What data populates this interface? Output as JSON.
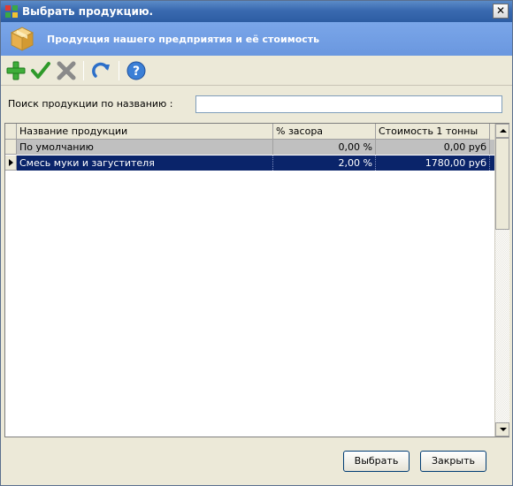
{
  "window": {
    "title": "Выбрать продукцию."
  },
  "banner": {
    "title": "Продукция нашего предприятия и её стоимость"
  },
  "toolbar": {
    "icons": [
      "add-icon",
      "accept-icon",
      "delete-icon",
      "refresh-icon",
      "help-icon"
    ]
  },
  "search": {
    "label": "Поиск продукции по названию :",
    "value": ""
  },
  "grid": {
    "columns": [
      "Название продукции",
      "% засора",
      "Стоимость 1 тонны"
    ],
    "rows": [
      {
        "name": "По умолчанию",
        "percent": "0,00 %",
        "price": "0,00 руб"
      },
      {
        "name": "Смесь муки и загустителя",
        "percent": "2,00 %",
        "price": "1780,00 руб"
      }
    ]
  },
  "buttons": {
    "select": "Выбрать",
    "close": "Закрыть"
  },
  "colors": {
    "selection": "#0a246a",
    "banner": "#6a97df",
    "titlebar": "#3a6ab0"
  }
}
